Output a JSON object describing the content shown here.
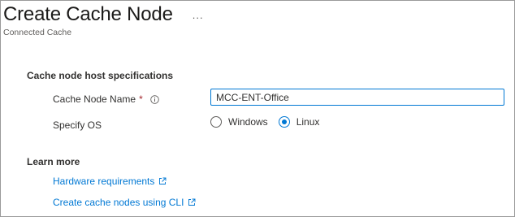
{
  "header": {
    "title": "Create Cache Node",
    "more_label": "...",
    "subtitle": "Connected Cache"
  },
  "host_specs": {
    "section_title": "Cache node host specifications",
    "name_label": "Cache Node Name",
    "required_mark": "*",
    "name_value": "MCC-ENT-Office",
    "os_label": "Specify OS",
    "os_options": [
      {
        "label": "Windows",
        "selected": false
      },
      {
        "label": "Linux",
        "selected": true
      }
    ]
  },
  "learn_more": {
    "section_title": "Learn more",
    "links": [
      {
        "label": "Hardware requirements"
      },
      {
        "label": "Create cache nodes using CLI"
      }
    ]
  },
  "colors": {
    "accent": "#0078d4",
    "text": "#323130",
    "required": "#a4262c",
    "muted": "#605e5c"
  },
  "icons": {
    "more": "more-horizontal-icon",
    "info": "info-icon",
    "external": "external-link-icon"
  }
}
